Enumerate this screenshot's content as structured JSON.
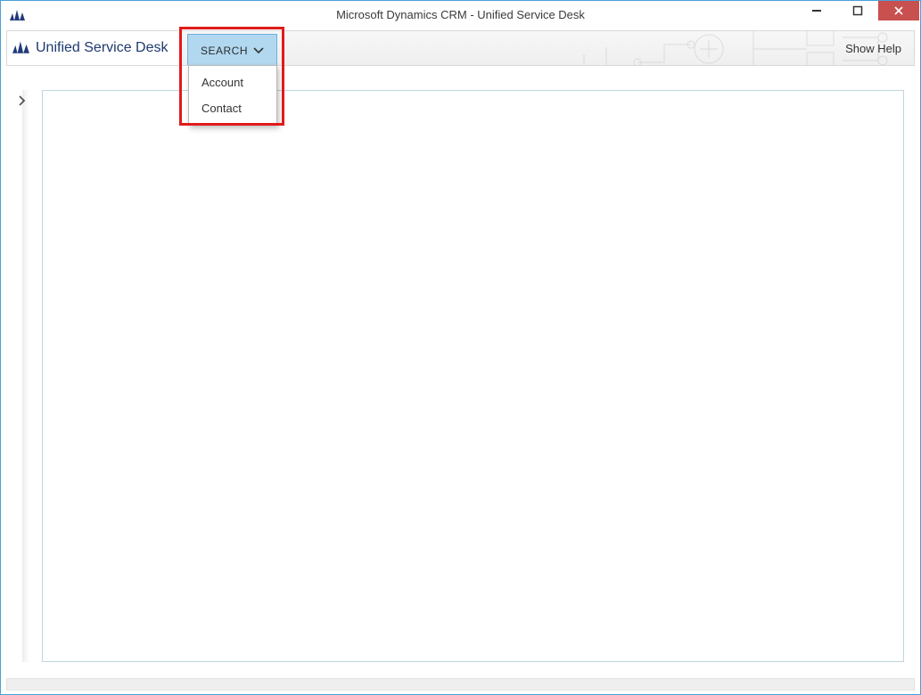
{
  "window": {
    "title": "Microsoft Dynamics CRM - Unified Service Desk"
  },
  "toolbar": {
    "brand": "Unified Service Desk",
    "search_label": "SEARCH",
    "help_label": "Show Help"
  },
  "search_menu": {
    "items": [
      {
        "label": "Account"
      },
      {
        "label": "Contact"
      }
    ]
  }
}
